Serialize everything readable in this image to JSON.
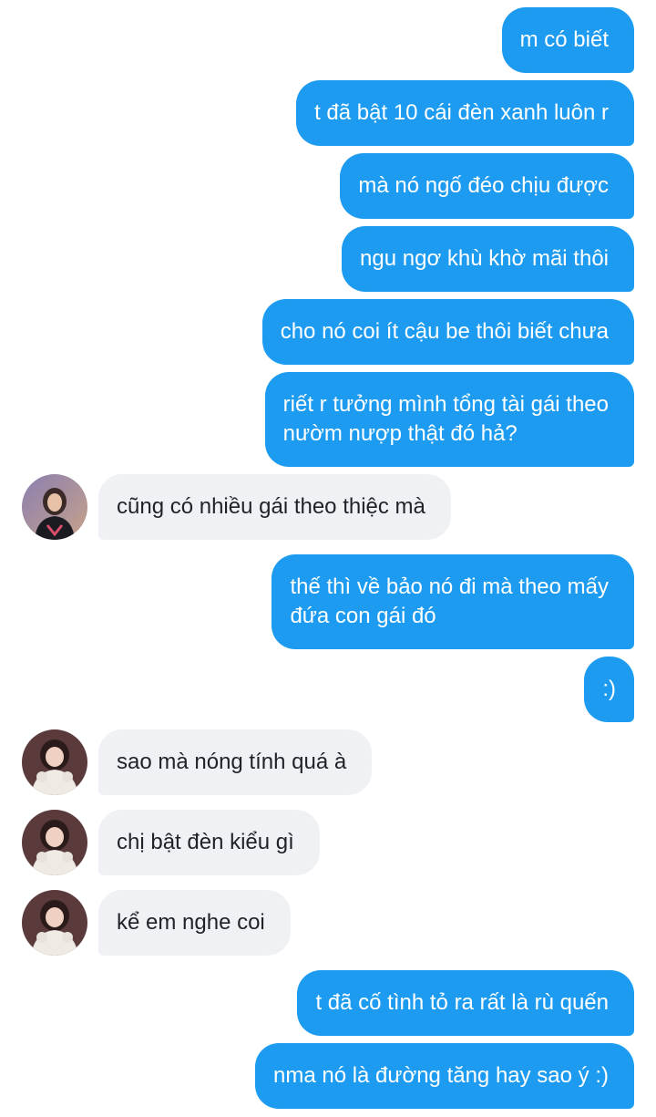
{
  "conversation": {
    "messages": [
      {
        "direction": "outgoing",
        "text": "m có biết"
      },
      {
        "direction": "outgoing",
        "text": "t đã bật 10 cái đèn xanh luôn r"
      },
      {
        "direction": "outgoing",
        "text": "mà nó ngố đéo chịu được"
      },
      {
        "direction": "outgoing",
        "text": "ngu ngơ khù khờ mãi thôi"
      },
      {
        "direction": "outgoing",
        "text": "cho nó coi ít cậu be thôi biết chưa"
      },
      {
        "direction": "outgoing",
        "line1": "riết r tưởng mình tổng tài gái theo",
        "line2": "nườm nượp thật đó hả?"
      },
      {
        "direction": "incoming",
        "text": "cũng có nhiều gái theo thiệc mà"
      },
      {
        "direction": "outgoing",
        "line1": "thế thì về bảo nó đi mà theo mấy",
        "line2": "đứa con gái đó"
      },
      {
        "direction": "outgoing",
        "text": ":)"
      },
      {
        "direction": "incoming",
        "text": "sao mà nóng tính quá à"
      },
      {
        "direction": "incoming",
        "text": "chị bật đèn kiểu gì"
      },
      {
        "direction": "incoming",
        "text": "kể em nghe coi"
      },
      {
        "direction": "outgoing",
        "text": "t đã cố tình tỏ ra rất là rù quến"
      },
      {
        "direction": "outgoing",
        "text": "nma nó là đường tăng hay sao ý :)"
      }
    ]
  },
  "colors": {
    "outgoing_bubble": "#1d9bf0",
    "outgoing_text": "#ffffff",
    "incoming_bubble": "#eff1f4",
    "incoming_text": "#1f2328"
  },
  "icons": {
    "avatar": "contact-avatar-photo"
  }
}
